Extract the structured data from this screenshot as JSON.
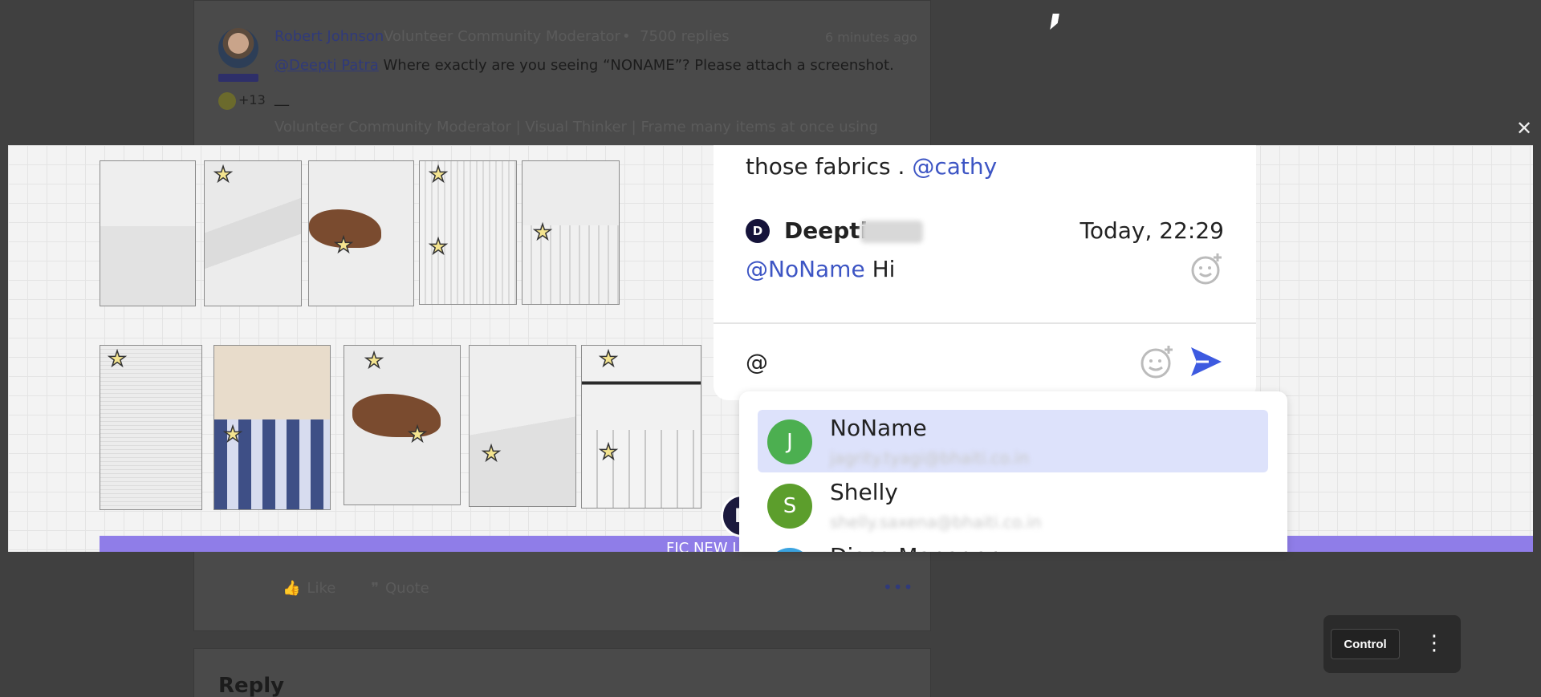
{
  "post": {
    "author": "Robert Johnson",
    "role": "Volunteer Community Moderator",
    "separator": "•",
    "replies": "7500 replies",
    "time": "6 minutes ago",
    "mention": "@Deepti Patra",
    "text": " Where exactly are you seeing “NONAME”? Please attach a screenshot.",
    "badge_count": "+13",
    "sig_line": "__",
    "signature": "Volunteer Community Moderator | Visual Thinker | Frame many items at once using",
    "actions": {
      "like": "Like",
      "quote": "Quote"
    },
    "more": "•••"
  },
  "reply": {
    "title": "Reply"
  },
  "lightbox": {
    "close_icon": "✕",
    "band_text": "FIC NEW L",
    "overlay_avatar_letter": "D"
  },
  "chat": {
    "prev_text": "those fabrics . ",
    "prev_mention": "@cathy",
    "message": {
      "avatar_letter": "D",
      "author_first": "Deepti",
      "time": "Today, 22:29",
      "mention": "@NoName",
      "text": " Hi"
    },
    "input_value": "@"
  },
  "mention_list": [
    {
      "letter": "J",
      "name": "NoName",
      "email": "jagrity.tyagi@bhaiti.co.in",
      "color": "#4caf50",
      "active": true
    },
    {
      "letter": "S",
      "name": "Shelly",
      "email": "shelly.saxena@bhaiti.co.in",
      "color": "#5c9e2c",
      "active": false
    },
    {
      "letter": "D",
      "name": "Disco Manager",
      "email": "",
      "color": "#3aa3e0",
      "active": false
    }
  ],
  "control": {
    "button_label": "Control",
    "menu_icon": "⋮"
  },
  "colors": {
    "accent": "#3d55c4",
    "mention_highlight": "#dde2fb",
    "band": "#8f7de8"
  }
}
